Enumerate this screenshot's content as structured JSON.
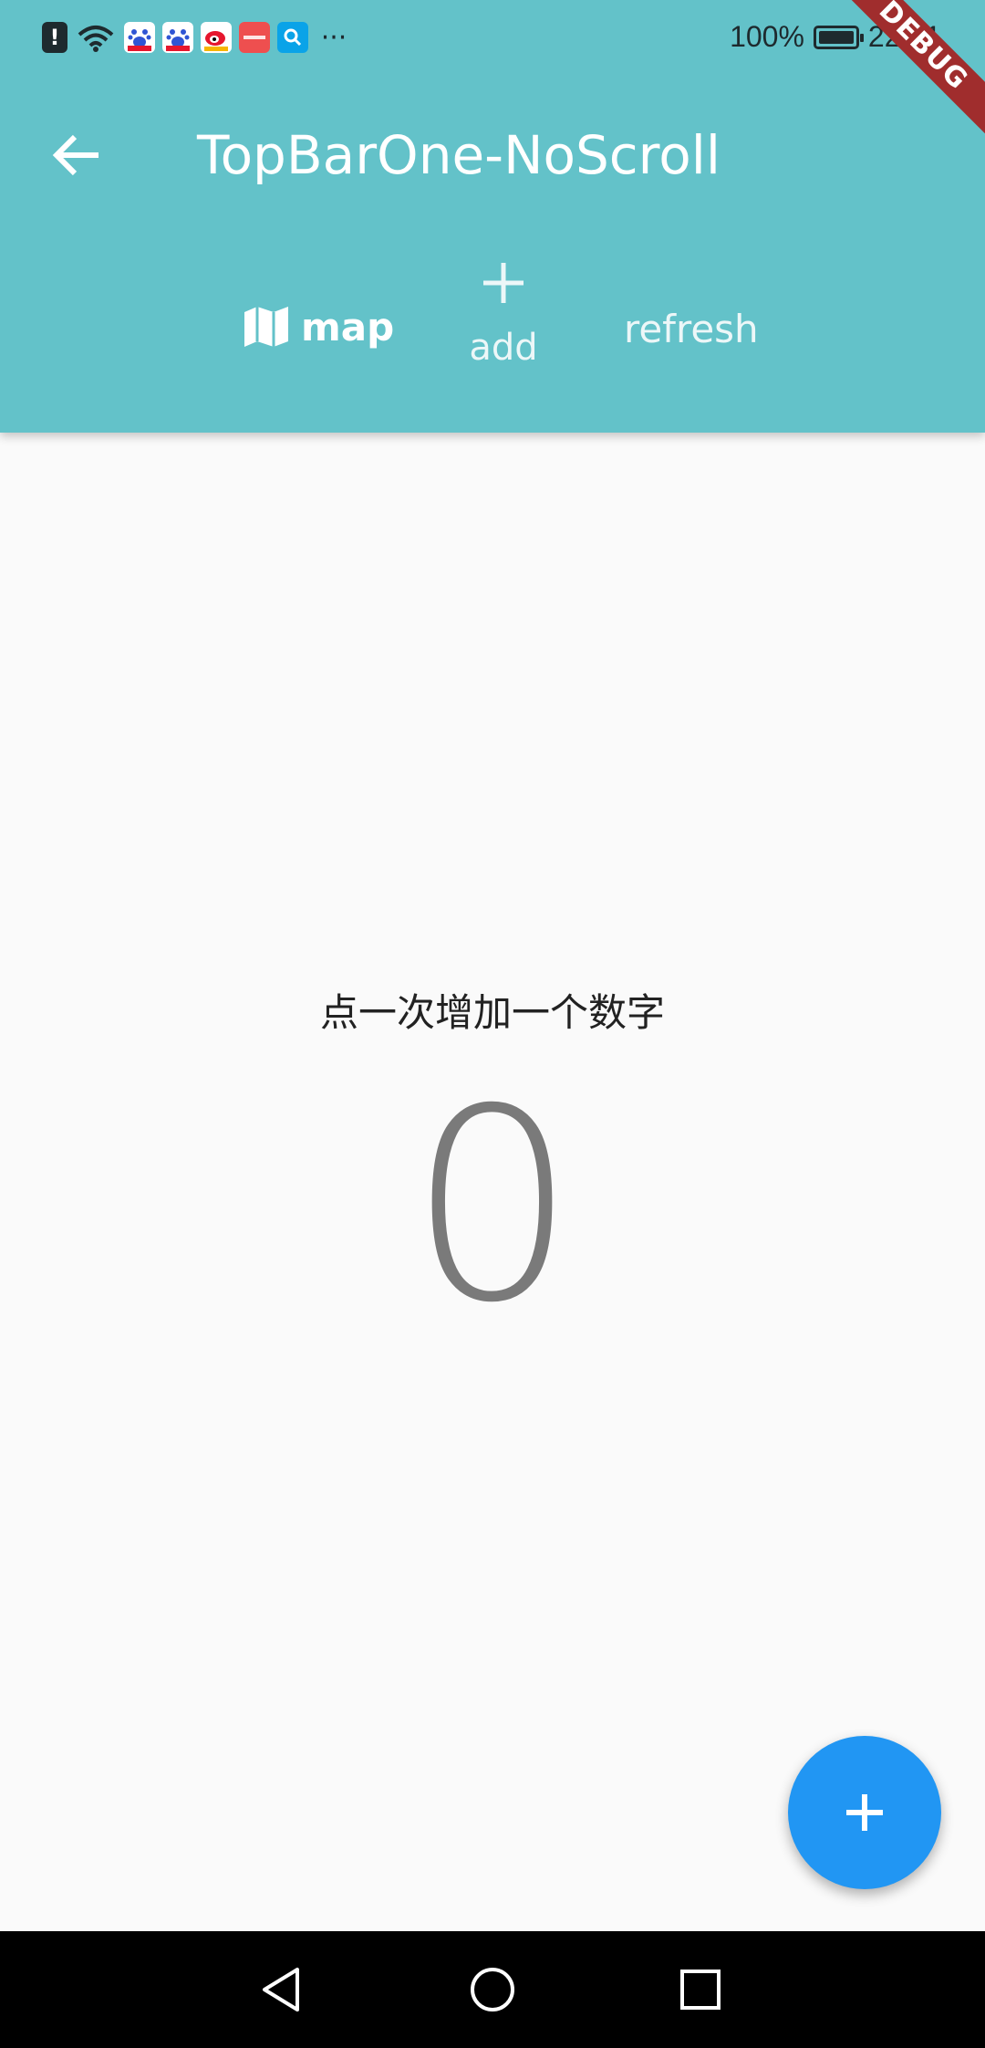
{
  "status_bar": {
    "battery_percent": "100%",
    "time": "22:31",
    "battery_level": 1.0,
    "more_glyph": "···",
    "icons": [
      "alert-icon",
      "wifi-icon",
      "baidu-icon",
      "baidu-icon",
      "weibo-icon",
      "huawei-icon",
      "search-app-icon"
    ]
  },
  "debug_banner": "DEBUG",
  "appbar": {
    "title": "TopBarOne-NoScroll",
    "background": "#63c2c9",
    "actions": {
      "map_label": "map",
      "add_label": "add",
      "refresh_label": "refresh"
    }
  },
  "main": {
    "prompt": "点一次增加一个数字",
    "counter": "0"
  },
  "fab": {
    "icon": "plus-icon",
    "color": "#2196f3"
  },
  "navbar": {
    "buttons": [
      "back-icon",
      "home-icon",
      "recents-icon"
    ]
  }
}
